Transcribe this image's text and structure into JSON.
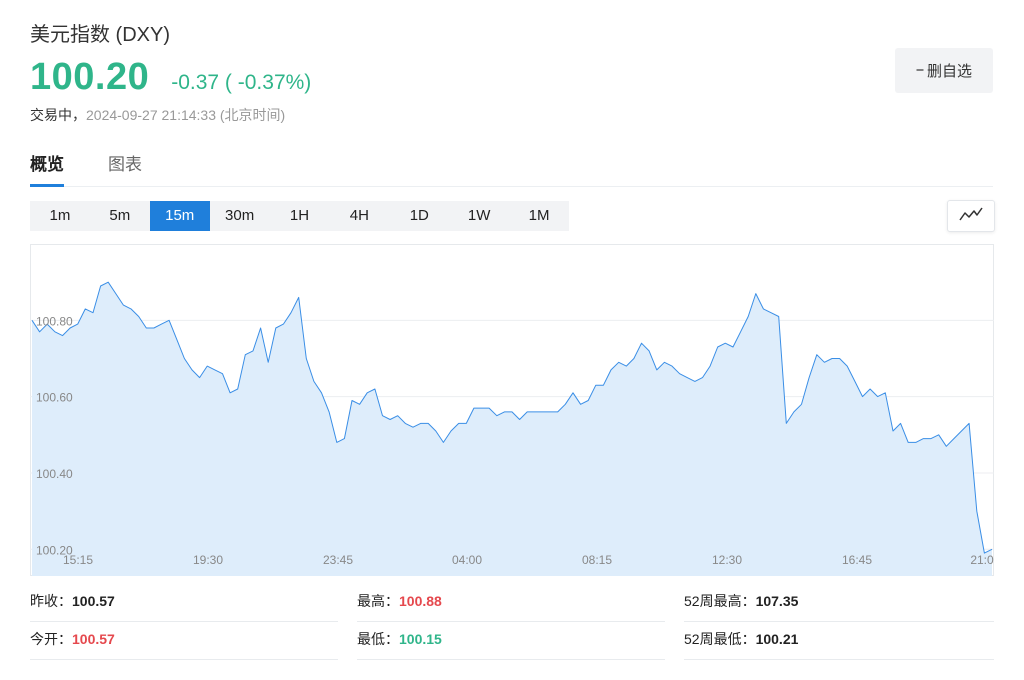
{
  "header": {
    "title": "美元指数 (DXY)",
    "price": "100.20",
    "change": "-0.37 ( -0.37%)",
    "status": "交易中，",
    "timestamp": "2024-09-27 21:14:33 (北京时间)",
    "remove_label": "删自选",
    "remove_icon": "minus-icon"
  },
  "tabs": [
    {
      "label": "概览",
      "active": true
    },
    {
      "label": "图表",
      "active": false
    }
  ],
  "intervals": [
    {
      "label": "1m",
      "active": false
    },
    {
      "label": "5m",
      "active": false
    },
    {
      "label": "15m",
      "active": true
    },
    {
      "label": "30m",
      "active": false
    },
    {
      "label": "1H",
      "active": false
    },
    {
      "label": "4H",
      "active": false
    },
    {
      "label": "1D",
      "active": false
    },
    {
      "label": "1W",
      "active": false
    },
    {
      "label": "1M",
      "active": false
    }
  ],
  "chart_type_icon": "line-chart-icon",
  "colors": {
    "accent": "#1f7fdb",
    "up": "#e5484d",
    "down": "#2fb58a",
    "line": "#3a8ee6",
    "fill": "#deedfb"
  },
  "chart_data": {
    "type": "area",
    "x_ticks": [
      "15:15",
      "19:30",
      "23:45",
      "04:00",
      "08:15",
      "12:30",
      "16:45",
      "21:0"
    ],
    "y_ticks": [
      "100.80",
      "100.60",
      "100.40",
      "100.20"
    ],
    "y_tick_values": [
      100.8,
      100.6,
      100.4,
      100.2
    ],
    "ylim": [
      100.13,
      101.0
    ],
    "n_slots": 92,
    "values": [
      100.8,
      100.77,
      100.79,
      100.77,
      100.76,
      100.78,
      100.79,
      100.83,
      100.82,
      100.89,
      100.9,
      100.87,
      100.84,
      100.83,
      100.81,
      100.78,
      100.78,
      100.79,
      100.8,
      100.75,
      100.7,
      100.67,
      100.65,
      100.68,
      100.67,
      100.66,
      100.61,
      100.62,
      100.71,
      100.72,
      100.78,
      100.69,
      100.78,
      100.79,
      100.82,
      100.86,
      100.7,
      100.64,
      100.61,
      100.56,
      100.48,
      100.49,
      100.59,
      100.58,
      100.61,
      100.62,
      100.55,
      100.54,
      100.55,
      100.53,
      100.52,
      100.53,
      100.53,
      100.51,
      100.48,
      100.51,
      100.53,
      100.53,
      100.57,
      100.57,
      100.57,
      100.55,
      100.56,
      100.56,
      100.54,
      100.56,
      100.56,
      100.56,
      100.56,
      100.56,
      100.58,
      100.61,
      100.58,
      100.59,
      100.63,
      100.63,
      100.67,
      100.69,
      100.68,
      100.7,
      100.74,
      100.72,
      100.67,
      100.69,
      100.68,
      100.66,
      100.65,
      100.64,
      100.65,
      100.68,
      100.73,
      100.74,
      100.73,
      100.77,
      100.81,
      100.87,
      100.83,
      100.82,
      100.81,
      100.53,
      100.56,
      100.58,
      100.65,
      100.71,
      100.69,
      100.7,
      100.7,
      100.68,
      100.64,
      100.6,
      100.62,
      100.6,
      100.61,
      100.51,
      100.53,
      100.48,
      100.48,
      100.49,
      100.49,
      100.5,
      100.47,
      100.49,
      100.51,
      100.53,
      100.3,
      100.19,
      100.2
    ]
  },
  "stats": {
    "prev_close_label": "昨收：",
    "prev_close": "100.57",
    "open_label": "今开：",
    "open": "100.57",
    "high_label": "最高：",
    "high": "100.88",
    "low_label": "最低：",
    "low": "100.15",
    "high52_label": "52周最高：",
    "high52": "107.35",
    "low52_label": "52周最低：",
    "low52": "100.21"
  }
}
